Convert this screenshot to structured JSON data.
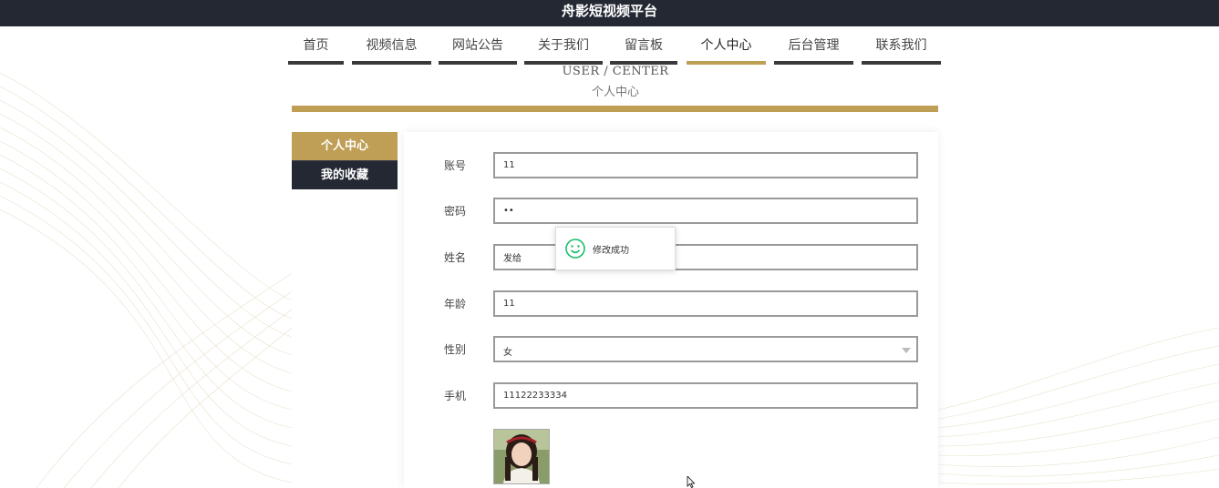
{
  "site": {
    "title": "舟影短视频平台"
  },
  "nav": {
    "items": [
      {
        "label": "首页"
      },
      {
        "label": "视频信息"
      },
      {
        "label": "网站公告"
      },
      {
        "label": "关于我们"
      },
      {
        "label": "留言板"
      },
      {
        "label": "个人中心",
        "active": true
      },
      {
        "label": "后台管理"
      },
      {
        "label": "联系我们"
      }
    ]
  },
  "page_heading": {
    "en": "USER / CENTER",
    "cn": "个人中心"
  },
  "sidebar": {
    "items": [
      {
        "label": "个人中心",
        "active": true
      },
      {
        "label": "我的收藏"
      }
    ]
  },
  "form": {
    "account": {
      "label": "账号",
      "value": "11"
    },
    "password": {
      "label": "密码",
      "value": "••"
    },
    "name": {
      "label": "姓名",
      "value": "发给"
    },
    "age": {
      "label": "年龄",
      "value": "11"
    },
    "gender": {
      "label": "性别",
      "value": "女"
    },
    "phone": {
      "label": "手机",
      "value": "11122233334"
    }
  },
  "toast": {
    "message": "修改成功"
  },
  "colors": {
    "accent": "#bf9e55",
    "dark": "#232833",
    "toast_icon": "#19be6b"
  }
}
